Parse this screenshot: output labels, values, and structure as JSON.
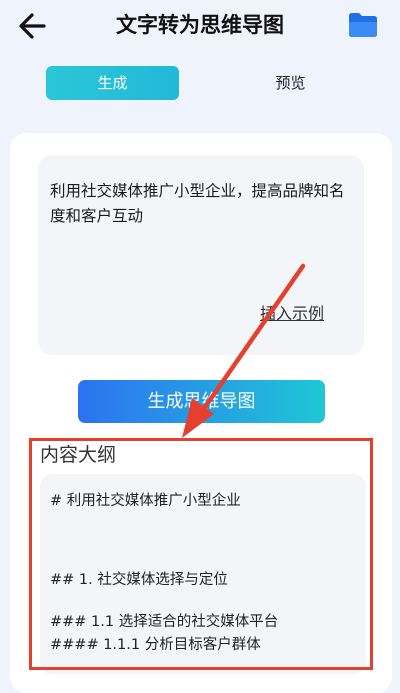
{
  "header": {
    "title": "文字转为思维导图"
  },
  "tabs": [
    {
      "label": "生成"
    },
    {
      "label": "预览"
    }
  ],
  "input": {
    "text": "利用社交媒体推广小型企业，提高品牌知名度和客户互动",
    "example_link": "插入示例"
  },
  "generate_button": "生成思维导图",
  "outline": {
    "title": "内容大纲",
    "lines": [
      "# 利用社交媒体推广小型企业",
      "## 1. 社交媒体选择与定位",
      "### 1.1 选择适合的社交媒体平台",
      "#### 1.1.1 分析目标客户群体"
    ]
  },
  "colors": {
    "accent_blue": "#2d72f0",
    "accent_cyan": "#2bc6d6",
    "annotation_red": "#e5402f"
  }
}
